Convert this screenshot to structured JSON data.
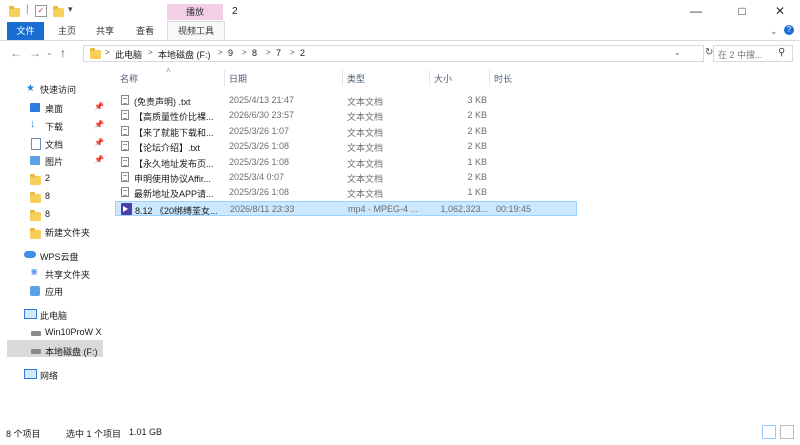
{
  "titlebar": {
    "title": "2",
    "contextual_tab": "播放"
  },
  "ribbon": {
    "tabs": [
      "文件",
      "主页",
      "共享",
      "查看",
      "视频工具"
    ]
  },
  "address": {
    "crumbs": [
      "此电脑",
      "本地磁盘 (F:)",
      "9",
      "8",
      "7",
      "2"
    ],
    "search_placeholder": "在 2 中搜..."
  },
  "nav": {
    "quick_access": "快速访问",
    "pinned": [
      "桌面",
      "下载",
      "文档",
      "图片"
    ],
    "folders": [
      "2",
      "8",
      "8",
      "新建文件夹"
    ],
    "wps_cloud": "WPS云盘",
    "wps_items": [
      "共享文件夹",
      "应用"
    ],
    "this_pc": "此电脑",
    "drives": [
      "Win10ProW X",
      "本地磁盘 (F:)"
    ],
    "network": "网络"
  },
  "columns": {
    "name": "名称",
    "date": "日期",
    "type": "类型",
    "size": "大小",
    "duration": "时长"
  },
  "files": [
    {
      "name": "(免责声明) .txt",
      "date": "2025/4/13 21:47",
      "type": "文本文档",
      "size": "3 KB",
      "duration": "",
      "icon": "text-file-icon"
    },
    {
      "name": "【高质量性价比裸...",
      "date": "2026/6/30 23:57",
      "type": "文本文档",
      "size": "2 KB",
      "duration": "",
      "icon": "text-file-icon"
    },
    {
      "name": "【来了就能下载和...",
      "date": "2025/3/26 1:07",
      "type": "文本文档",
      "size": "2 KB",
      "duration": "",
      "icon": "text-file-icon"
    },
    {
      "name": "【论坛介绍】.txt",
      "date": "2025/3/26 1:08",
      "type": "文本文档",
      "size": "2 KB",
      "duration": "",
      "icon": "text-file-icon"
    },
    {
      "name": "【永久地址发布页...",
      "date": "2025/3/26 1:08",
      "type": "文本文档",
      "size": "1 KB",
      "duration": "",
      "icon": "text-file-icon"
    },
    {
      "name": "申明使用协议Affir...",
      "date": "2025/3/4 0:07",
      "type": "文本文档",
      "size": "2 KB",
      "duration": "",
      "icon": "text-file-icon"
    },
    {
      "name": "最新地址及APP请...",
      "date": "2025/3/26 1:08",
      "type": "文本文档",
      "size": "1 KB",
      "duration": "",
      "icon": "text-file-icon"
    },
    {
      "name": "8.12 《20绑缚荃女...",
      "date": "2026/8/11 23:33",
      "type": "mp4 - MPEG-4 ...",
      "size": "1,062,323...",
      "duration": "00:19:45",
      "icon": "video-file-icon"
    }
  ],
  "status": {
    "count": "8 个项目",
    "selected": "选中 1 个项目",
    "selected_size": "1.01 GB"
  }
}
